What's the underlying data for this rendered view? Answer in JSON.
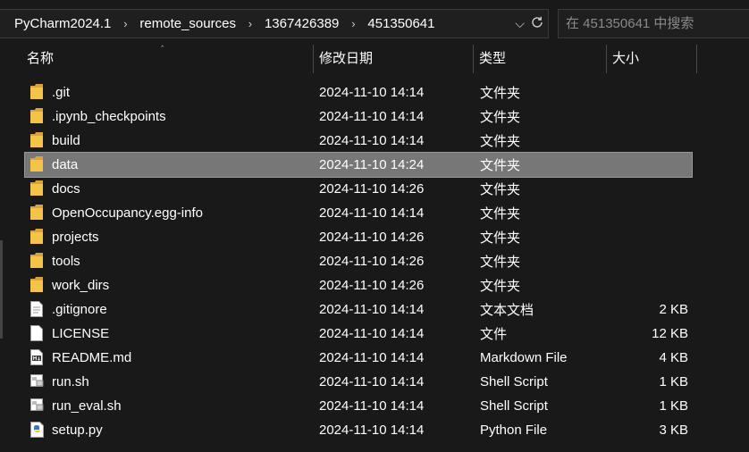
{
  "breadcrumb": {
    "items": [
      "PyCharm2024.1",
      "remote_sources",
      "1367426389",
      "451350641"
    ]
  },
  "search": {
    "placeholder": "在 451350641 中搜索"
  },
  "columns": {
    "name": "名称",
    "date": "修改日期",
    "type": "类型",
    "size": "大小"
  },
  "files": [
    {
      "name": ".git",
      "date": "2024-11-10 14:14",
      "type": "文件夹",
      "size": "",
      "icon": "folder-icon"
    },
    {
      "name": ".ipynb_checkpoints",
      "date": "2024-11-10 14:14",
      "type": "文件夹",
      "size": "",
      "icon": "folder-icon"
    },
    {
      "name": "build",
      "date": "2024-11-10 14:14",
      "type": "文件夹",
      "size": "",
      "icon": "folder-icon"
    },
    {
      "name": "data",
      "date": "2024-11-10 14:24",
      "type": "文件夹",
      "size": "",
      "icon": "folder-icon",
      "selected": true
    },
    {
      "name": "docs",
      "date": "2024-11-10 14:26",
      "type": "文件夹",
      "size": "",
      "icon": "folder-icon"
    },
    {
      "name": "OpenOccupancy.egg-info",
      "date": "2024-11-10 14:14",
      "type": "文件夹",
      "size": "",
      "icon": "folder-icon"
    },
    {
      "name": "projects",
      "date": "2024-11-10 14:26",
      "type": "文件夹",
      "size": "",
      "icon": "folder-icon"
    },
    {
      "name": "tools",
      "date": "2024-11-10 14:26",
      "type": "文件夹",
      "size": "",
      "icon": "folder-icon"
    },
    {
      "name": "work_dirs",
      "date": "2024-11-10 14:26",
      "type": "文件夹",
      "size": "",
      "icon": "folder-icon"
    },
    {
      "name": ".gitignore",
      "date": "2024-11-10 14:14",
      "type": "文本文档",
      "size": "2 KB",
      "icon": "text-file-icon"
    },
    {
      "name": "LICENSE",
      "date": "2024-11-10 14:14",
      "type": "文件",
      "size": "12 KB",
      "icon": "blank-file-icon"
    },
    {
      "name": "README.md",
      "date": "2024-11-10 14:14",
      "type": "Markdown File",
      "size": "4 KB",
      "icon": "markdown-file-icon"
    },
    {
      "name": "run.sh",
      "date": "2024-11-10 14:14",
      "type": "Shell Script",
      "size": "1 KB",
      "icon": "shell-script-icon"
    },
    {
      "name": "run_eval.sh",
      "date": "2024-11-10 14:14",
      "type": "Shell Script",
      "size": "1 KB",
      "icon": "shell-script-icon"
    },
    {
      "name": "setup.py",
      "date": "2024-11-10 14:14",
      "type": "Python File",
      "size": "3 KB",
      "icon": "python-file-icon"
    }
  ],
  "colors": {
    "background": "#191919",
    "selected_row": "#777777",
    "folder": "#f4c34a",
    "text": "#ffffff"
  }
}
